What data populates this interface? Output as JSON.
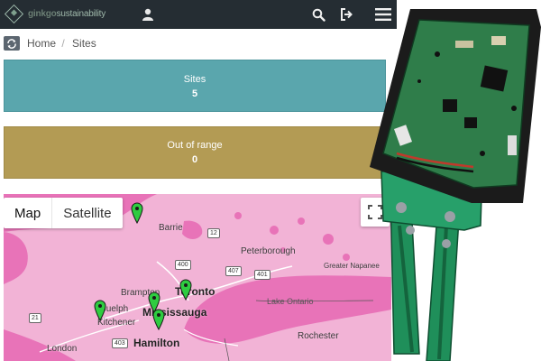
{
  "brand": {
    "name_bold": "ginkgo",
    "name_rest": "sustainability"
  },
  "breadcrumb": {
    "home": "Home",
    "separator": "/",
    "current": "Sites"
  },
  "cards": {
    "sites": {
      "title": "Sites",
      "value": "5",
      "color": "#5aa6ad"
    },
    "out_of_range": {
      "title": "Out of range",
      "value": "0",
      "color": "#b39b54"
    }
  },
  "map": {
    "type_buttons": {
      "map": "Map",
      "satellite": "Satellite"
    },
    "places": {
      "barrie": "Barrie",
      "peterborough": "Peterborough",
      "brampton": "Brampton",
      "toronto": "Toronto",
      "mississauga": "Mississauga",
      "guelph": "Guelph",
      "kitchener": "Kitchener",
      "hamilton": "Hamilton",
      "london": "London",
      "rochester": "Rochester",
      "lake_ontario": "Lake Ontario",
      "greater_napanee": "Greater Napanee"
    },
    "routes": [
      "12",
      "400",
      "407",
      "401",
      "21",
      "403"
    ],
    "pin_count": 5,
    "colors": {
      "land": "#f2b3d6",
      "water": "#e873b8",
      "pin": "#2ecc40"
    }
  },
  "icons": {
    "user": "user-icon",
    "search": "search-icon",
    "logout": "logout-icon",
    "menu": "hamburger-menu-icon",
    "refresh": "refresh-icon",
    "fullscreen": "fullscreen-icon",
    "pin": "map-pin-icon"
  }
}
